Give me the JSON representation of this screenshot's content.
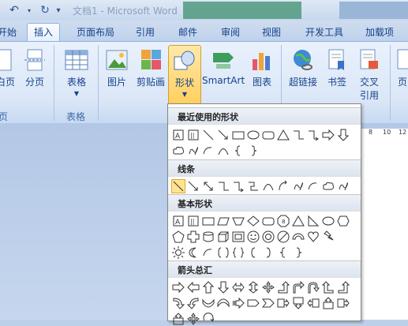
{
  "titlebar": {
    "undo_icon": "undo-icon",
    "redo_icon": "redo-icon",
    "title": "文档1 - Microsoft Word"
  },
  "tabs": [
    "开始",
    "插入",
    "页面布局",
    "引用",
    "邮件",
    "审阅",
    "视图",
    "开发工具",
    "加载项"
  ],
  "active_tab": "插入",
  "ribbon": {
    "pages_btn_a": "白页",
    "pages_btn_b": "分页",
    "pages_group": "页",
    "table_btn": "表格",
    "table_group": "表格",
    "picture_btn": "图片",
    "clipart_btn": "剪贴画",
    "shapes_btn": "形状",
    "smartart_btn": "SmartArt",
    "chart_btn": "图表",
    "hyperlink_btn": "超链接",
    "bookmark_btn": "书签",
    "crossref_btn_l1": "交叉",
    "crossref_btn_l2": "引用",
    "page_btn_partial": "页"
  },
  "ruler": {
    "n1": "8",
    "n2": "10",
    "n3": "12"
  },
  "dropdown": {
    "sections": [
      "最近使用的形状",
      "线条",
      "基本形状",
      "箭头总汇"
    ]
  },
  "colors": {
    "accent": "#15428b",
    "highlight": "#ffe38e",
    "ribbon_bg": "#dbe7f7"
  }
}
